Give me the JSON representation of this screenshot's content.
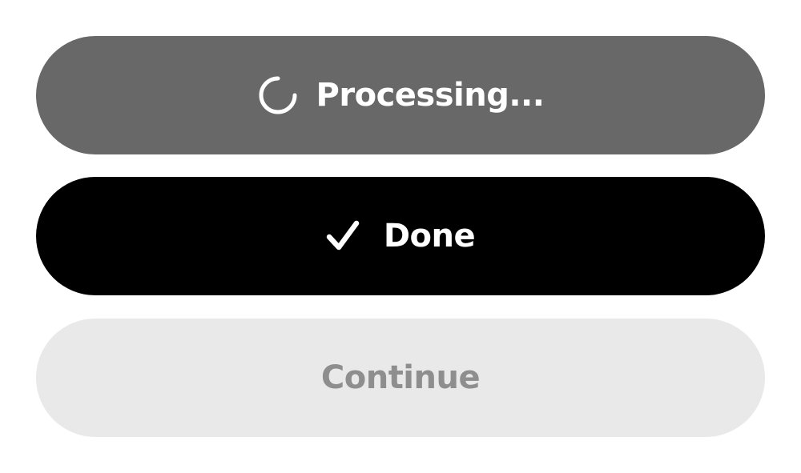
{
  "buttons": {
    "processing": {
      "label": "Processing...",
      "icon": "spinner-icon",
      "state": "loading",
      "color": "#686868"
    },
    "done": {
      "label": "Done",
      "icon": "check-icon",
      "state": "success",
      "color": "#000000"
    },
    "continue": {
      "label": "Continue",
      "state": "disabled",
      "color": "#e9e9e9",
      "text_color": "#8e8e8e"
    }
  }
}
